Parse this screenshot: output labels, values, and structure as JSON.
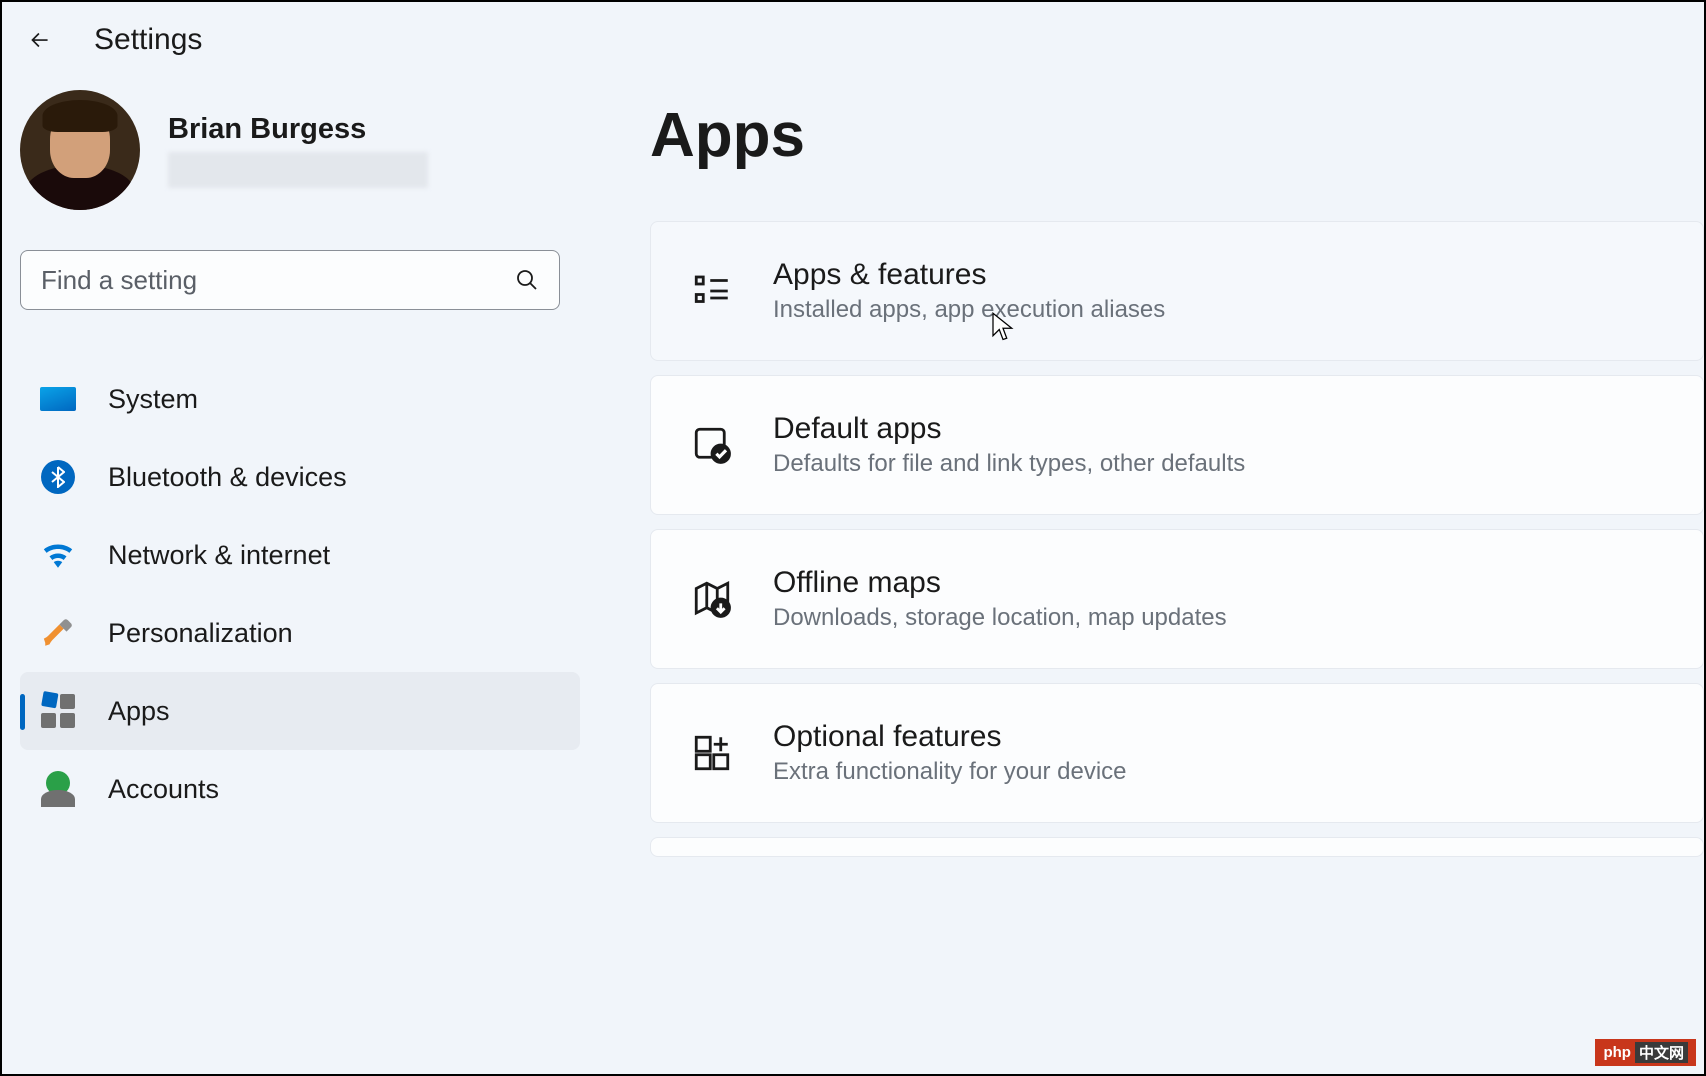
{
  "header": {
    "title": "Settings"
  },
  "user": {
    "name": "Brian Burgess"
  },
  "search": {
    "placeholder": "Find a setting"
  },
  "nav": {
    "items": [
      {
        "label": "System"
      },
      {
        "label": "Bluetooth & devices"
      },
      {
        "label": "Network & internet"
      },
      {
        "label": "Personalization"
      },
      {
        "label": "Apps"
      },
      {
        "label": "Accounts"
      }
    ]
  },
  "main": {
    "title": "Apps",
    "cards": [
      {
        "title": "Apps & features",
        "subtitle": "Installed apps, app execution aliases"
      },
      {
        "title": "Default apps",
        "subtitle": "Defaults for file and link types, other defaults"
      },
      {
        "title": "Offline maps",
        "subtitle": "Downloads, storage location, map updates"
      },
      {
        "title": "Optional features",
        "subtitle": "Extra functionality for your device"
      }
    ]
  },
  "watermark": {
    "a": "php",
    "b": "中文网"
  }
}
